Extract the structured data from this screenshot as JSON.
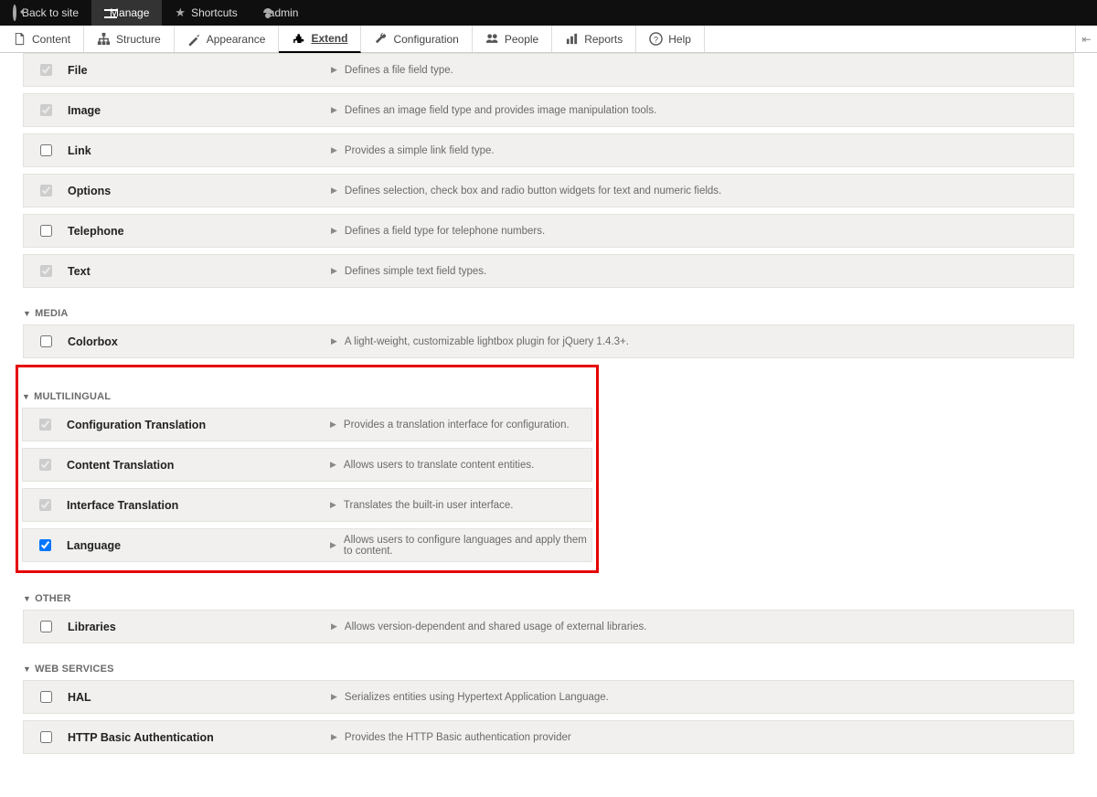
{
  "toolbar": {
    "back": "Back to site",
    "manage": "Manage",
    "shortcuts": "Shortcuts",
    "user": "admin"
  },
  "tabs": {
    "content": "Content",
    "structure": "Structure",
    "appearance": "Appearance",
    "extend": "Extend",
    "configuration": "Configuration",
    "people": "People",
    "reports": "Reports",
    "help": "Help"
  },
  "groups": [
    {
      "rows": [
        {
          "checked": true,
          "disabled": true,
          "name": "File",
          "desc": "Defines a file field type."
        },
        {
          "checked": true,
          "disabled": true,
          "name": "Image",
          "desc": "Defines an image field type and provides image manipulation tools."
        },
        {
          "checked": false,
          "disabled": false,
          "name": "Link",
          "desc": "Provides a simple link field type."
        },
        {
          "checked": true,
          "disabled": true,
          "name": "Options",
          "desc": "Defines selection, check box and radio button widgets for text and numeric fields."
        },
        {
          "checked": false,
          "disabled": false,
          "name": "Telephone",
          "desc": "Defines a field type for telephone numbers."
        },
        {
          "checked": true,
          "disabled": true,
          "name": "Text",
          "desc": "Defines simple text field types."
        }
      ]
    },
    {
      "title": "MEDIA",
      "rows": [
        {
          "checked": false,
          "disabled": false,
          "name": "Colorbox",
          "desc": "A light-weight, customizable lightbox plugin for jQuery 1.4.3+."
        }
      ]
    },
    {
      "title": "MULTILINGUAL",
      "highlight": true,
      "rows": [
        {
          "checked": true,
          "disabled": true,
          "name": "Configuration Translation",
          "desc": "Provides a translation interface for configuration."
        },
        {
          "checked": true,
          "disabled": true,
          "name": "Content Translation",
          "desc": "Allows users to translate content entities."
        },
        {
          "checked": true,
          "disabled": true,
          "name": "Interface Translation",
          "desc": "Translates the built-in user interface."
        },
        {
          "checked": true,
          "disabled": false,
          "name": "Language",
          "desc": "Allows users to configure languages and apply them to content."
        }
      ]
    },
    {
      "title": "OTHER",
      "rows": [
        {
          "checked": false,
          "disabled": false,
          "name": "Libraries",
          "desc": "Allows version-dependent and shared usage of external libraries."
        }
      ]
    },
    {
      "title": "WEB SERVICES",
      "rows": [
        {
          "checked": false,
          "disabled": false,
          "name": "HAL",
          "desc": "Serializes entities using Hypertext Application Language."
        },
        {
          "checked": false,
          "disabled": false,
          "name": "HTTP Basic Authentication",
          "desc": "Provides the HTTP Basic authentication provider"
        }
      ]
    }
  ]
}
